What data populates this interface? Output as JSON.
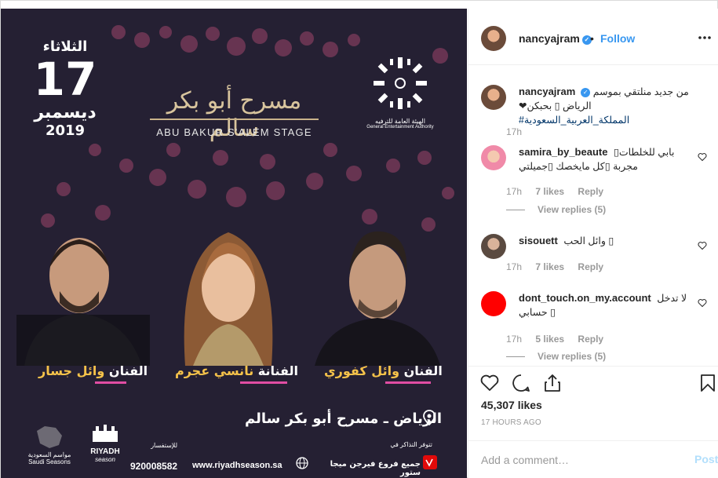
{
  "poster": {
    "date_day_name": "الثلاثاء",
    "date_day_num": "17",
    "date_month": "ديسمبر",
    "date_year": "2019",
    "venue_ar": "مسرح أبو بكر سالم",
    "venue_en": "ABU BAKUR S'ALEM STAGE",
    "gea_ar": "الهيئة العامة للترفيه",
    "gea_en": "General Entertainment Authority",
    "artists": [
      {
        "title": "الفنان",
        "name": "وائل جسار"
      },
      {
        "title": "الفنانة",
        "name": "نانسي عجرم"
      },
      {
        "title": "الفنان",
        "name": "وائل كفوري"
      }
    ],
    "location": "الرياض ـ مسرح أبو بكر سالم",
    "seasons_ar": "مواسم السعودية",
    "seasons_en": "Saudi Seasons",
    "riyadh_logo": "RIYADH",
    "riyadh_sub": "season",
    "inquiry_label": "للإستفسار",
    "phone": "920008582",
    "website": "www.riyadhseason.sa",
    "tickets_label": "تتوفر التذاكر في",
    "stores": "جميع فروع فيرجن ميجا ستور"
  },
  "header": {
    "username": "nancyajram",
    "separator": "•",
    "follow_label": "Follow",
    "icons": {
      "verified": "verified-badge-icon",
      "more": "more-options-icon"
    }
  },
  "caption": {
    "username": "nancyajram",
    "text": "من جديد منلتقي بموسم الرياض ▯ بحبكن❤ ",
    "hashtag": "#المملكة_العربية_السعودية",
    "time": "17h"
  },
  "comments": [
    {
      "username": "samira_by_beaute",
      "text": "بابي للخلطات▯ مجربة ▯كل مايخصك ▯جميلتي",
      "time": "17h",
      "likes": "7 likes",
      "reply": "Reply",
      "view_replies": "View replies (5)"
    },
    {
      "username": "sisouett",
      "text": "وائل الحب ▯",
      "time": "17h",
      "likes": "7 likes",
      "reply": "Reply"
    },
    {
      "username": "dont_touch.on_my.account",
      "text": "لا تدخل حسابي ▯",
      "time": "17h",
      "likes": "5 likes",
      "reply": "Reply",
      "view_replies": "View replies (5)"
    }
  ],
  "likes_count": "45,307 likes",
  "time_ago": "17 HOURS AGO",
  "add_comment": {
    "placeholder": "Add a comment…",
    "post_label": "Post"
  },
  "colors": {
    "accent": "#3897f0",
    "poster_bg": "#252033",
    "name_gold": "#f5c24a",
    "underline_pink": "#e04da3",
    "red_avatar": "#ff0000"
  }
}
